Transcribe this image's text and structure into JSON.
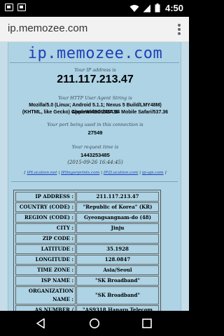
{
  "status_bar": {
    "time": "4:50",
    "icons": [
      "image-notification-icon",
      "screenshot-notification-icon",
      "wifi-icon",
      "cell-signal-icon",
      "battery-icon"
    ]
  },
  "browser": {
    "url": "ip.memozee.com",
    "menu_icon": "overflow-menu-icon"
  },
  "page": {
    "site_title": "ip.memozee.com",
    "ip_caption": "Your IP address is",
    "ip_address": "211.117.213.47",
    "ua_caption": "Your HTTP User Agent String is",
    "user_agent_line1": "Mozilla/5.0 (Linux; Android 5.1.1; Nexus 5 Build/LMY48M) AppleWebKit/537.36",
    "user_agent_line2": "(KHTML, like Gecko) Chrome/45.0.2454.94 Mobile Safari/537.36",
    "port_caption": "Your port being used in this connection is",
    "port": "27549",
    "time_caption": "Your request time is",
    "request_time": "1443253485",
    "request_date": "(2015-09-26 16:44:45)",
    "links": [
      "IPLocation.net",
      "IPfingerprints.com",
      "IP2Location.com",
      "ip-api.com"
    ],
    "colors": {
      "background": "#c5dde8",
      "panel": "#add3e4",
      "title": "#1e3fb8",
      "link": "#1a3fbf"
    }
  },
  "info_table": [
    {
      "key": "IP ADDRESS :",
      "value": "211.117.213.47"
    },
    {
      "key": "COUNTRY (CODE) :",
      "value": "\"Republic of Korea\" (KR)"
    },
    {
      "key": "REGION (CODE) :",
      "value": "Gyeongsangnam-do (48)"
    },
    {
      "key": "CITY :",
      "value": "Jinju"
    },
    {
      "key": "ZIP CODE :",
      "value": ""
    },
    {
      "key": "LATITUDE :",
      "value": "35.1928"
    },
    {
      "key": "LONGITUDE :",
      "value": "128.0847"
    },
    {
      "key": "TIME ZONE :",
      "value": "Asia/Seoul"
    },
    {
      "key": "ISP NAME :",
      "value": "\"SK Broadband\""
    },
    {
      "key": "ORGANIZATION NAME :",
      "value": "\"SK Broadband\""
    },
    {
      "key": "AS NUMBER / NAME :",
      "value": "\"AS9318 Hanaro Telecom Inc.\""
    }
  ],
  "nav_bar": {
    "buttons": [
      "back-icon",
      "home-icon",
      "recents-icon"
    ]
  }
}
